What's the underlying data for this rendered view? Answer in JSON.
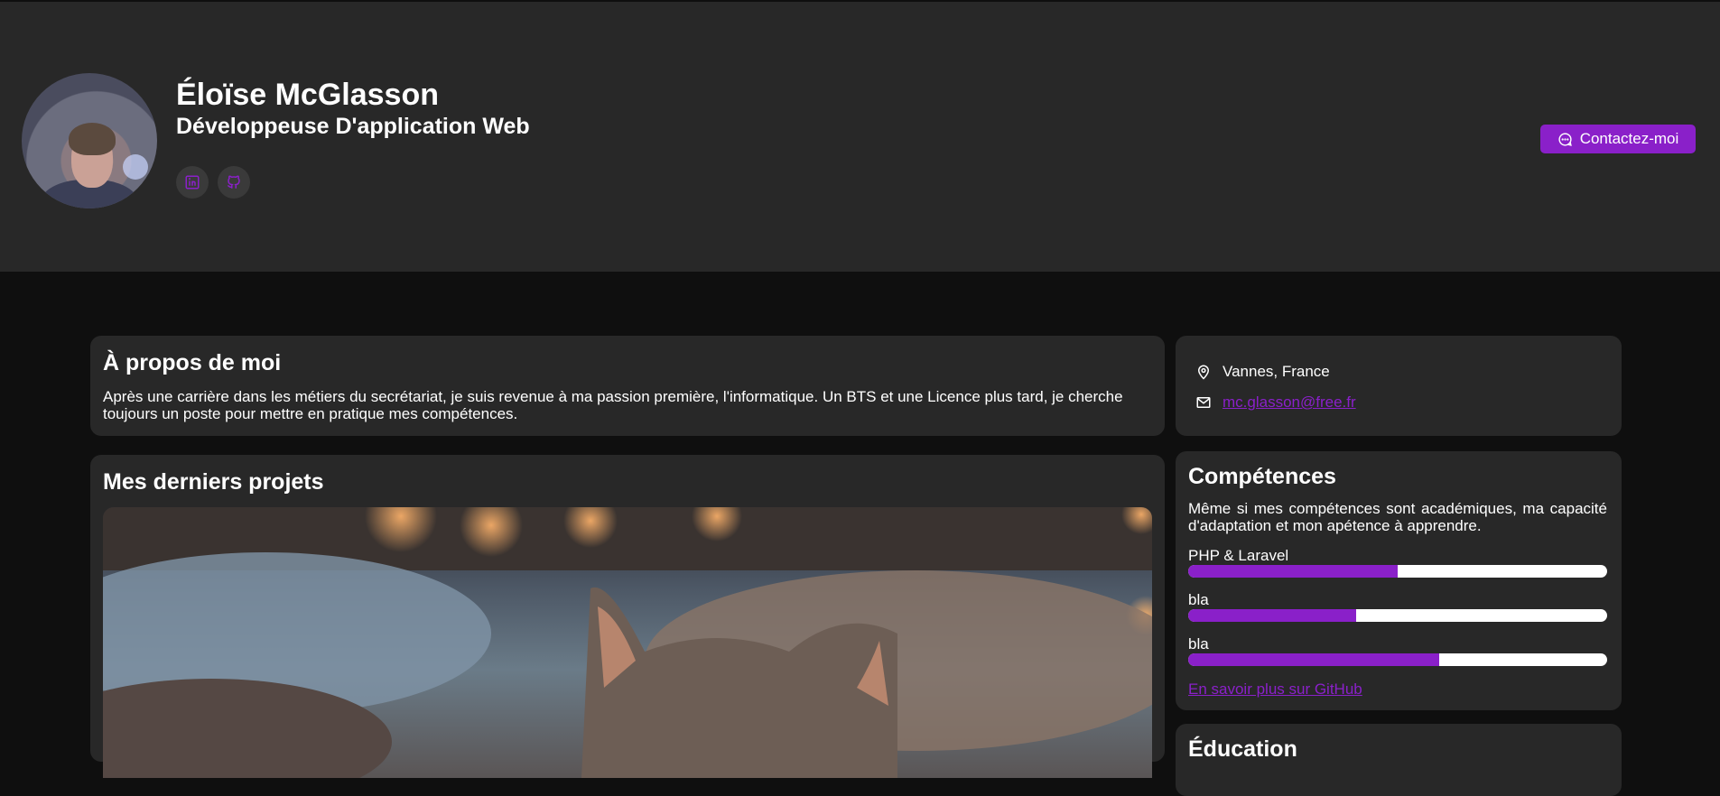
{
  "header": {
    "name": "Éloïse McGlasson",
    "role": "Développeuse D'application Web",
    "social": [
      {
        "icon": "linkedin-icon"
      },
      {
        "icon": "github-icon"
      }
    ],
    "contact_label": "Contactez-moi"
  },
  "about": {
    "title": "À propos de moi",
    "text": "Après une carrière dans les métiers du secrétariat, je suis revenue à ma passion première, l'informatique. Un BTS et une Licence plus tard, je cherche toujours un poste pour mettre en pratique mes compétences."
  },
  "info": {
    "location": "Vannes, France",
    "email": "mc.glasson@free.fr"
  },
  "projects": {
    "title": "Mes derniers projets"
  },
  "skills": {
    "title": "Compétences",
    "intro": "Même si mes compétences sont académiques, ma capacité d'adaptation et mon apétence à apprendre.",
    "items": [
      {
        "label": "PHP & Laravel",
        "level": 0.5
      },
      {
        "label": "bla",
        "level": 0.4
      },
      {
        "label": "bla",
        "level": 0.6
      }
    ],
    "github_link": "En savoir plus sur GitHub"
  },
  "education": {
    "title": "Éducation"
  },
  "colors": {
    "accent": "#8a20c9",
    "header_bg": "#282828",
    "page_bg": "#0f0f0f",
    "card_bg": "#282828"
  }
}
